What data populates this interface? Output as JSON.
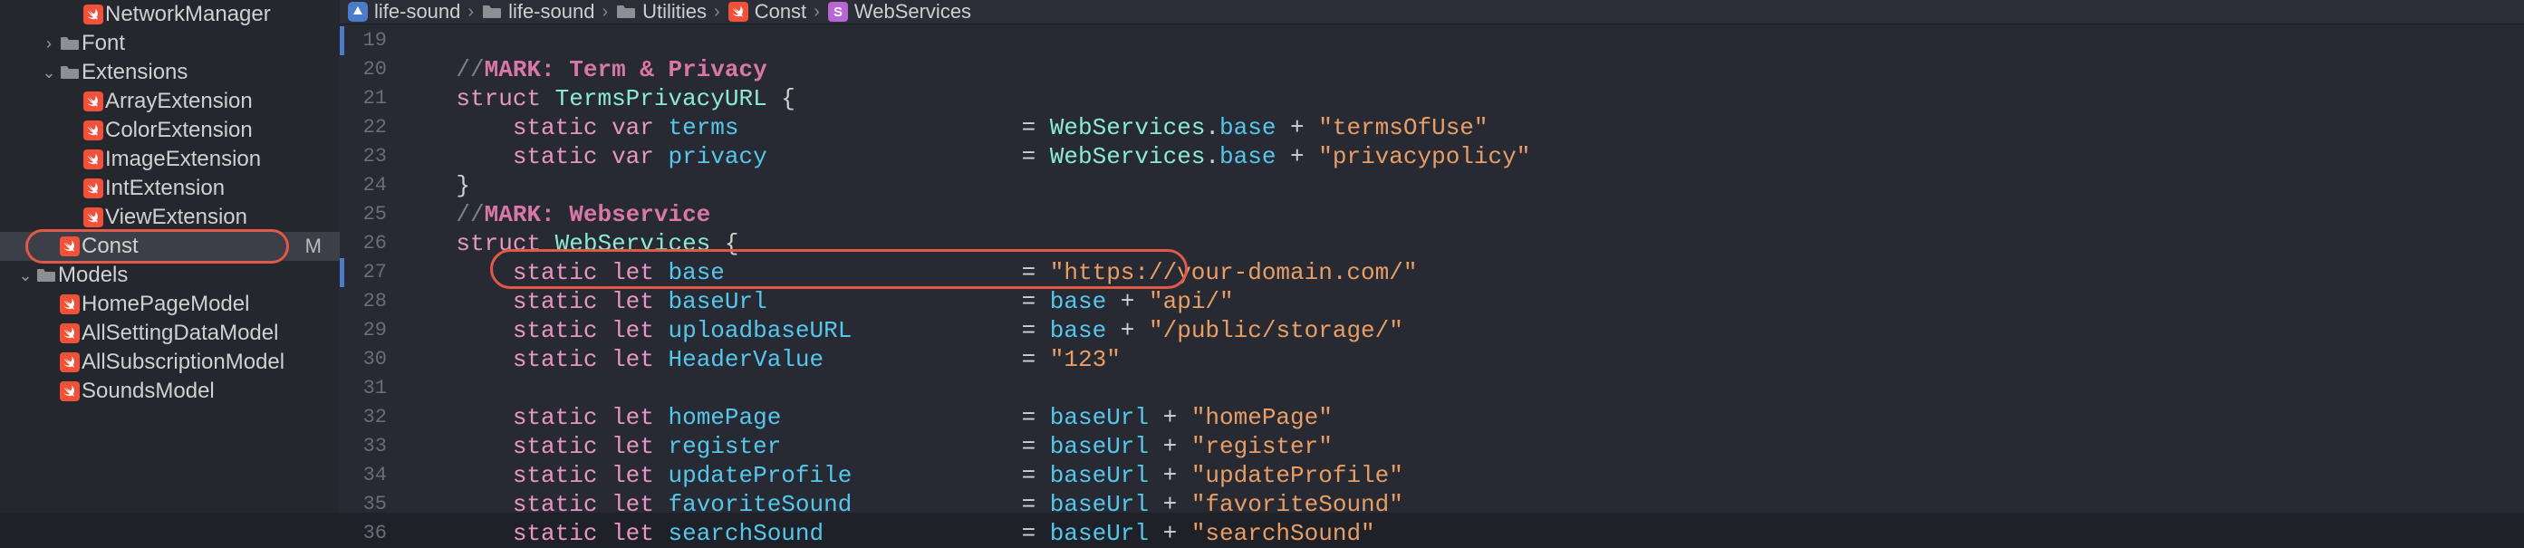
{
  "sidebar": {
    "items": [
      {
        "label": "NetworkManager",
        "icon": "swift",
        "indent": 3,
        "disclosure": "",
        "selected": false,
        "truncated": true
      },
      {
        "label": "Font",
        "icon": "folder",
        "indent": 2,
        "disclosure": "right",
        "selected": false
      },
      {
        "label": "Extensions",
        "icon": "folder",
        "indent": 2,
        "disclosure": "down",
        "selected": false
      },
      {
        "label": "ArrayExtension",
        "icon": "swift",
        "indent": 3,
        "disclosure": "",
        "selected": false
      },
      {
        "label": "ColorExtension",
        "icon": "swift",
        "indent": 3,
        "disclosure": "",
        "selected": false
      },
      {
        "label": "ImageExtension",
        "icon": "swift",
        "indent": 3,
        "disclosure": "",
        "selected": false
      },
      {
        "label": "IntExtension",
        "icon": "swift",
        "indent": 3,
        "disclosure": "",
        "selected": false
      },
      {
        "label": "ViewExtension",
        "icon": "swift",
        "indent": 3,
        "disclosure": "",
        "selected": false
      },
      {
        "label": "Const",
        "icon": "swift",
        "indent": 2,
        "disclosure": "",
        "selected": true,
        "badge": "M",
        "circle": true
      },
      {
        "label": "Models",
        "icon": "folder",
        "indent": 1,
        "disclosure": "down",
        "selected": false
      },
      {
        "label": "HomePageModel",
        "icon": "swift",
        "indent": 2,
        "disclosure": "",
        "selected": false
      },
      {
        "label": "AllSettingDataModel",
        "icon": "swift",
        "indent": 2,
        "disclosure": "",
        "selected": false
      },
      {
        "label": "AllSubscriptionModel",
        "icon": "swift",
        "indent": 2,
        "disclosure": "",
        "selected": false
      },
      {
        "label": "SoundsModel",
        "icon": "swift",
        "indent": 2,
        "disclosure": "",
        "selected": false,
        "truncated": true
      }
    ]
  },
  "breadcrumb": {
    "items": [
      {
        "icon": "app",
        "label": "life-sound"
      },
      {
        "icon": "folder",
        "label": "life-sound"
      },
      {
        "icon": "folder",
        "label": "Utilities"
      },
      {
        "icon": "swift",
        "label": "Const"
      },
      {
        "icon": "struct",
        "label": "WebServices"
      }
    ]
  },
  "editor": {
    "first_line_number": 19,
    "change_bars": [
      {
        "start": 19,
        "end": 19
      },
      {
        "start": 27,
        "end": 27
      }
    ],
    "lines": [
      {
        "n": 19,
        "tokens": []
      },
      {
        "n": 20,
        "tokens": [
          {
            "t": "    ",
            "c": "plain"
          },
          {
            "t": "//",
            "c": "comment"
          },
          {
            "t": "MARK: Term & Privacy",
            "c": "mark"
          }
        ]
      },
      {
        "n": 21,
        "tokens": [
          {
            "t": "    ",
            "c": "plain"
          },
          {
            "t": "struct",
            "c": "kw"
          },
          {
            "t": " ",
            "c": "plain"
          },
          {
            "t": "TermsPrivacyURL",
            "c": "type"
          },
          {
            "t": " {",
            "c": "plain"
          }
        ]
      },
      {
        "n": 22,
        "tokens": [
          {
            "t": "        ",
            "c": "plain"
          },
          {
            "t": "static",
            "c": "kw"
          },
          {
            "t": " ",
            "c": "plain"
          },
          {
            "t": "var",
            "c": "kw"
          },
          {
            "t": " ",
            "c": "plain"
          },
          {
            "t": "terms",
            "c": "ident"
          },
          {
            "pad": 44
          },
          {
            "t": "= ",
            "c": "plain"
          },
          {
            "t": "WebServices",
            "c": "type"
          },
          {
            "t": ".",
            "c": "plain"
          },
          {
            "t": "base",
            "c": "prop"
          },
          {
            "t": " + ",
            "c": "plain"
          },
          {
            "t": "\"termsOfUse\"",
            "c": "str"
          }
        ]
      },
      {
        "n": 23,
        "tokens": [
          {
            "t": "        ",
            "c": "plain"
          },
          {
            "t": "static",
            "c": "kw"
          },
          {
            "t": " ",
            "c": "plain"
          },
          {
            "t": "var",
            "c": "kw"
          },
          {
            "t": " ",
            "c": "plain"
          },
          {
            "t": "privacy",
            "c": "ident"
          },
          {
            "pad": 44
          },
          {
            "t": "= ",
            "c": "plain"
          },
          {
            "t": "WebServices",
            "c": "type"
          },
          {
            "t": ".",
            "c": "plain"
          },
          {
            "t": "base",
            "c": "prop"
          },
          {
            "t": " + ",
            "c": "plain"
          },
          {
            "t": "\"privacypolicy\"",
            "c": "str"
          }
        ]
      },
      {
        "n": 24,
        "tokens": [
          {
            "t": "    }",
            "c": "plain"
          }
        ]
      },
      {
        "n": 25,
        "tokens": [
          {
            "t": "    ",
            "c": "plain"
          },
          {
            "t": "//",
            "c": "comment"
          },
          {
            "t": "MARK: Webservice",
            "c": "mark"
          }
        ]
      },
      {
        "n": 26,
        "tokens": [
          {
            "t": "    ",
            "c": "plain"
          },
          {
            "t": "struct",
            "c": "kw"
          },
          {
            "t": " ",
            "c": "plain"
          },
          {
            "t": "WebServices",
            "c": "type"
          },
          {
            "t": " {",
            "c": "plain"
          }
        ]
      },
      {
        "n": 27,
        "tokens": [
          {
            "t": "        ",
            "c": "plain"
          },
          {
            "t": "static",
            "c": "kw"
          },
          {
            "t": " ",
            "c": "plain"
          },
          {
            "t": "let",
            "c": "kw"
          },
          {
            "t": " ",
            "c": "plain"
          },
          {
            "t": "base",
            "c": "ident"
          },
          {
            "pad": 44
          },
          {
            "t": "= ",
            "c": "plain"
          },
          {
            "t": "\"https://your-domain.com/\"",
            "c": "str"
          }
        ]
      },
      {
        "n": 28,
        "tokens": [
          {
            "t": "        ",
            "c": "plain"
          },
          {
            "t": "static",
            "c": "kw"
          },
          {
            "t": " ",
            "c": "plain"
          },
          {
            "t": "let",
            "c": "kw"
          },
          {
            "t": " ",
            "c": "plain"
          },
          {
            "t": "baseUrl",
            "c": "ident"
          },
          {
            "pad": 44
          },
          {
            "t": "= ",
            "c": "plain"
          },
          {
            "t": "base",
            "c": "prop"
          },
          {
            "t": " + ",
            "c": "plain"
          },
          {
            "t": "\"api/\"",
            "c": "str"
          }
        ]
      },
      {
        "n": 29,
        "tokens": [
          {
            "t": "        ",
            "c": "plain"
          },
          {
            "t": "static",
            "c": "kw"
          },
          {
            "t": " ",
            "c": "plain"
          },
          {
            "t": "let",
            "c": "kw"
          },
          {
            "t": " ",
            "c": "plain"
          },
          {
            "t": "uploadbaseURL",
            "c": "ident"
          },
          {
            "pad": 44
          },
          {
            "t": "= ",
            "c": "plain"
          },
          {
            "t": "base",
            "c": "prop"
          },
          {
            "t": " + ",
            "c": "plain"
          },
          {
            "t": "\"/public/storage/\"",
            "c": "str"
          }
        ]
      },
      {
        "n": 30,
        "tokens": [
          {
            "t": "        ",
            "c": "plain"
          },
          {
            "t": "static",
            "c": "kw"
          },
          {
            "t": " ",
            "c": "plain"
          },
          {
            "t": "let",
            "c": "kw"
          },
          {
            "t": " ",
            "c": "plain"
          },
          {
            "t": "HeaderValue",
            "c": "ident"
          },
          {
            "pad": 44
          },
          {
            "t": "= ",
            "c": "plain"
          },
          {
            "t": "\"123\"",
            "c": "str"
          }
        ]
      },
      {
        "n": 31,
        "tokens": []
      },
      {
        "n": 32,
        "tokens": [
          {
            "t": "        ",
            "c": "plain"
          },
          {
            "t": "static",
            "c": "kw"
          },
          {
            "t": " ",
            "c": "plain"
          },
          {
            "t": "let",
            "c": "kw"
          },
          {
            "t": " ",
            "c": "plain"
          },
          {
            "t": "homePage",
            "c": "ident"
          },
          {
            "pad": 44
          },
          {
            "t": "= ",
            "c": "plain"
          },
          {
            "t": "baseUrl",
            "c": "prop"
          },
          {
            "t": " + ",
            "c": "plain"
          },
          {
            "t": "\"homePage\"",
            "c": "str"
          }
        ]
      },
      {
        "n": 33,
        "tokens": [
          {
            "t": "        ",
            "c": "plain"
          },
          {
            "t": "static",
            "c": "kw"
          },
          {
            "t": " ",
            "c": "plain"
          },
          {
            "t": "let",
            "c": "kw"
          },
          {
            "t": " ",
            "c": "plain"
          },
          {
            "t": "register",
            "c": "ident"
          },
          {
            "pad": 44
          },
          {
            "t": "= ",
            "c": "plain"
          },
          {
            "t": "baseUrl",
            "c": "prop"
          },
          {
            "t": " + ",
            "c": "plain"
          },
          {
            "t": "\"register\"",
            "c": "str"
          }
        ]
      },
      {
        "n": 34,
        "tokens": [
          {
            "t": "        ",
            "c": "plain"
          },
          {
            "t": "static",
            "c": "kw"
          },
          {
            "t": " ",
            "c": "plain"
          },
          {
            "t": "let",
            "c": "kw"
          },
          {
            "t": " ",
            "c": "plain"
          },
          {
            "t": "updateProfile",
            "c": "ident"
          },
          {
            "pad": 44
          },
          {
            "t": "= ",
            "c": "plain"
          },
          {
            "t": "baseUrl",
            "c": "prop"
          },
          {
            "t": " + ",
            "c": "plain"
          },
          {
            "t": "\"updateProfile\"",
            "c": "str"
          }
        ]
      },
      {
        "n": 35,
        "tokens": [
          {
            "t": "        ",
            "c": "plain"
          },
          {
            "t": "static",
            "c": "kw"
          },
          {
            "t": " ",
            "c": "plain"
          },
          {
            "t": "let",
            "c": "kw"
          },
          {
            "t": " ",
            "c": "plain"
          },
          {
            "t": "favoriteSound",
            "c": "ident"
          },
          {
            "pad": 44
          },
          {
            "t": "= ",
            "c": "plain"
          },
          {
            "t": "baseUrl",
            "c": "prop"
          },
          {
            "t": " + ",
            "c": "plain"
          },
          {
            "t": "\"favoriteSound\"",
            "c": "str"
          }
        ]
      },
      {
        "n": 36,
        "tokens": [
          {
            "t": "        ",
            "c": "plain"
          },
          {
            "t": "static",
            "c": "kw"
          },
          {
            "t": " ",
            "c": "plain"
          },
          {
            "t": "let",
            "c": "kw"
          },
          {
            "t": " ",
            "c": "plain"
          },
          {
            "t": "searchSound",
            "c": "ident"
          },
          {
            "pad": 44
          },
          {
            "t": "= ",
            "c": "plain"
          },
          {
            "t": "baseUrl",
            "c": "prop"
          },
          {
            "t": " + ",
            "c": "plain"
          },
          {
            "t": "\"searchSound\"",
            "c": "str"
          }
        ]
      }
    ],
    "highlight_line": 27
  }
}
